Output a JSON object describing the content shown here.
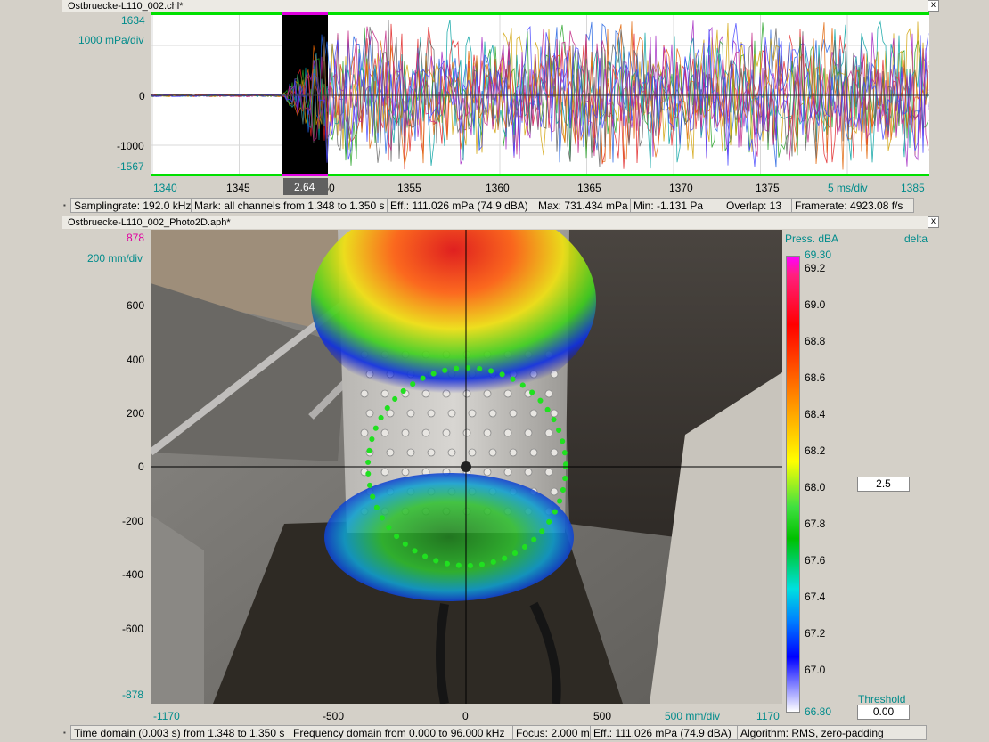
{
  "top_window": {
    "title": "Ostbruecke-L110_002.chl*",
    "close_label": "x",
    "y_max": "1634",
    "y_scale": "1000 mPa/div",
    "y_ticks": [
      "0",
      "-1000"
    ],
    "y_min": "-1567",
    "x_ticks": [
      "1340",
      "1345",
      "1350",
      "1355",
      "1360",
      "1365",
      "1370",
      "1375",
      "1385"
    ],
    "x_scale": "5 ms/div",
    "marker_value": "2.64",
    "colors": {
      "bound_line": "#00e000",
      "marker": "#e000e0",
      "selection": "#000000"
    },
    "status": [
      "Samplingrate: 192.0 kHz",
      "Mark: all channels from 1.348 to 1.350 s",
      "Eff.: 111.026 mPa (74.9 dBA)",
      "Max: 731.434 mPa",
      "Min: -1.131 Pa",
      "Overlap: 13",
      "Framerate: 4923.08 f/s"
    ]
  },
  "bottom_window": {
    "title": "Ostbruecke-L110_002_Photo2D.aph*",
    "close_label": "x",
    "y_max": "878",
    "y_scale": "200 mm/div",
    "y_ticks": [
      "600",
      "400",
      "200",
      "0",
      "-200",
      "-400",
      "-600"
    ],
    "y_min": "-878",
    "x_min": "-1170",
    "x_ticks": [
      "-500",
      "0",
      "500"
    ],
    "x_scale": "500 mm/div",
    "x_max": "1170",
    "colorbar": {
      "title": "Press. dBA",
      "delta_label": "delta",
      "max_label": "69.30",
      "ticks": [
        "69.2",
        "69.0",
        "68.8",
        "68.6",
        "68.4",
        "68.2",
        "68.0",
        "67.8",
        "67.6",
        "67.4",
        "67.2",
        "67.0"
      ],
      "min_label": "66.80"
    },
    "delta_value": "2.5",
    "threshold_label": "Threshold",
    "threshold_value": "0.00",
    "status": [
      "Time domain (0.003 s) from 1.348 to 1.350 s",
      "Frequency domain from 0.000 to 96.000 kHz",
      "Focus: 2.000 m",
      "Eff.: 111.026 mPa (74.9 dBA)",
      "Algorithm: RMS, zero-padding"
    ]
  }
}
